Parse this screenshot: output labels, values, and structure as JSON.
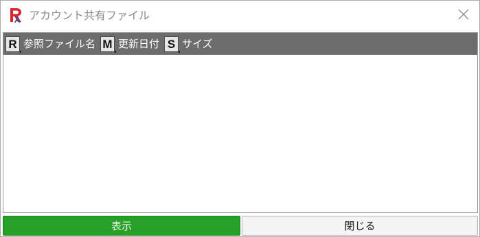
{
  "window": {
    "title": "アカウント共有ファイル",
    "app_icon": "app-logo-icon",
    "close_icon": "close-icon"
  },
  "list": {
    "columns": [
      {
        "key": "R",
        "label": "参照ファイル名"
      },
      {
        "key": "M",
        "label": "更新日付"
      },
      {
        "key": "S",
        "label": "サイズ"
      }
    ],
    "rows": []
  },
  "buttons": {
    "show_label": "表示",
    "close_label": "閉じる"
  },
  "colors": {
    "header_bg": "#6d6d6d",
    "show_button_bg": "#27a027",
    "logo_red": "#d6262b",
    "logo_blue": "#2f4aa8"
  }
}
